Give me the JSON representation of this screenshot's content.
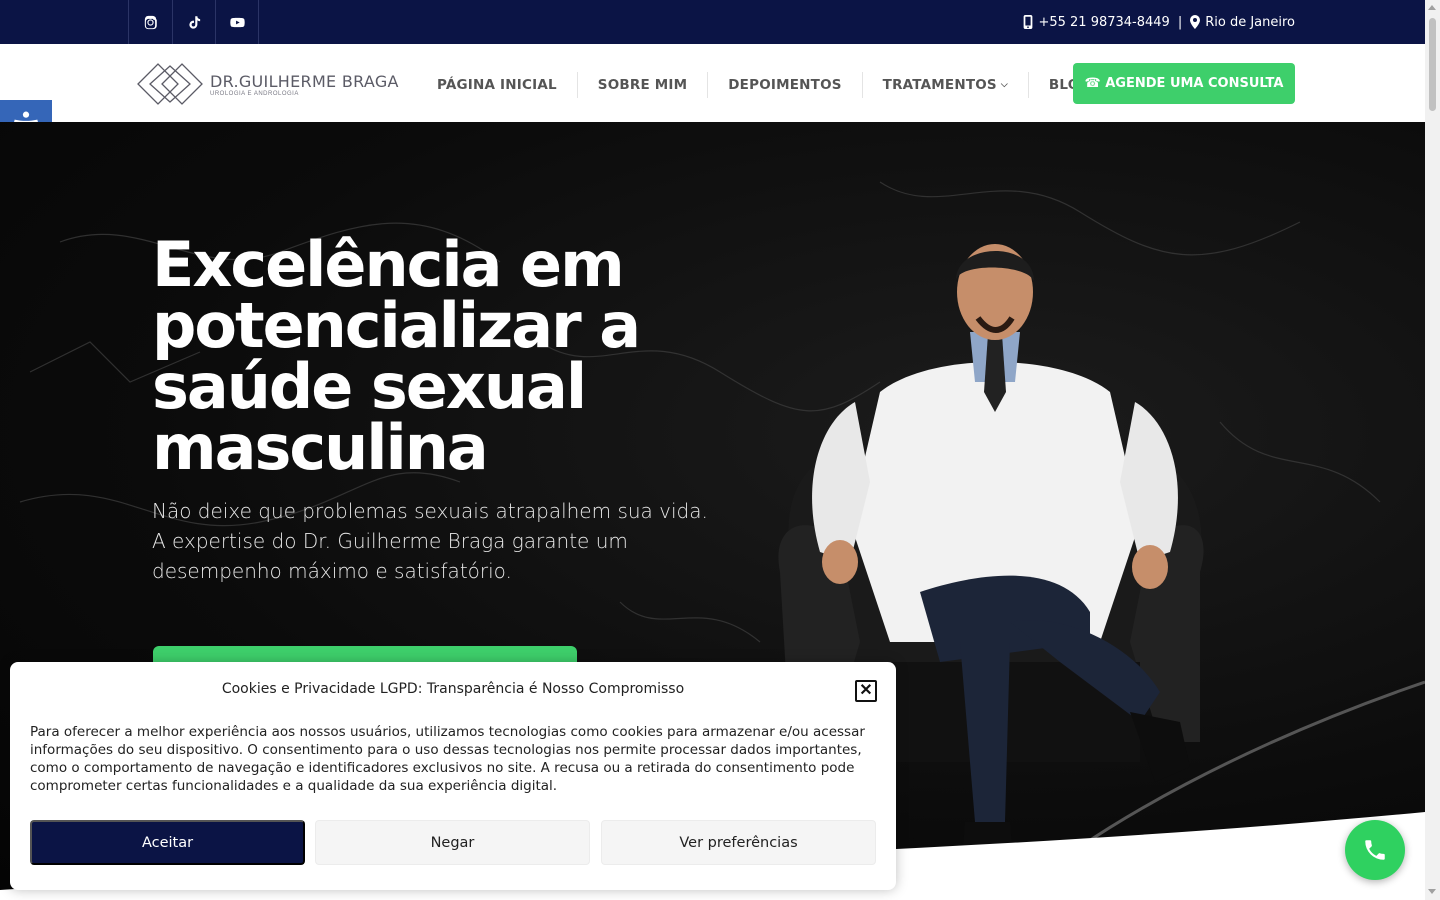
{
  "topbar": {
    "socials": [
      {
        "icon": "instagram-icon"
      },
      {
        "icon": "tiktok-icon"
      },
      {
        "icon": "youtube-icon"
      }
    ],
    "phone": "+55 21 98734-8449",
    "separator": "|",
    "location": "Rio de Janeiro"
  },
  "header": {
    "logo_name": "DR.GUILHERME BRAGA",
    "logo_sub": "UROLOGIA E ANDROLOGIA",
    "nav": [
      "PÁGINA INICIAL",
      "SOBRE MIM",
      "DEPOIMENTOS",
      "TRATAMENTOS",
      "BLOG"
    ],
    "cta": "☎ AGENDE UMA CONSULTA"
  },
  "hero": {
    "title": "Excelência em potencializar a saúde sexual masculina",
    "subtitle": "Não deixe que problemas sexuais atrapalhem sua vida. A expertise do Dr. Guilherme Braga garante um desempenho máximo e satisfatório."
  },
  "cookie": {
    "title": "Cookies e Privacidade LGPD: Transparência é Nosso Compromisso",
    "body": "Para oferecer a melhor experiência aos nossos usuários, utilizamos tecnologias como cookies para armazenar e/ou acessar informações do seu dispositivo. O consentimento para o uso dessas tecnologias nos permite processar dados importantes, como o comportamento de navegação e identificadores exclusivos no site. A recusa ou a retirada do consentimento pode comprometer certas funcionalidades e a qualidade da sua experiência digital.",
    "accept": "Aceitar",
    "deny": "Negar",
    "prefs": "Ver preferências",
    "close": "✕"
  },
  "colors": {
    "topbar": "#0b1445",
    "accent_green": "#3ecf6b",
    "a11y_blue": "#3566b8"
  }
}
